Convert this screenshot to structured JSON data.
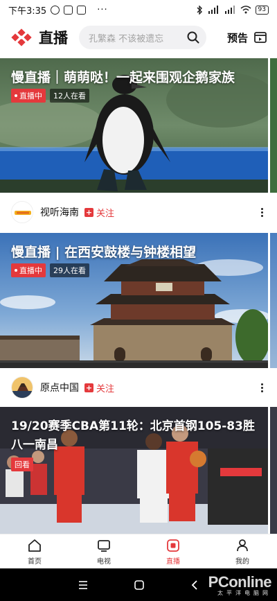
{
  "status_bar": {
    "time": "下午3:35",
    "dots": "···",
    "battery": "93"
  },
  "header": {
    "title": "直播",
    "search_placeholder": "孔繁森 不该被遗忘",
    "preview_label": "预告"
  },
  "cards": [
    {
      "title": "慢直播｜萌萌哒！一起来围观企鹅家族",
      "live_badge": "直播中",
      "viewers": "12人在看",
      "author": "视听海南",
      "follow_label": "关注"
    },
    {
      "title": "慢直播 | 在西安鼓楼与钟楼相望",
      "live_badge": "直播中",
      "viewers": "29人在看",
      "author": "原点中国",
      "follow_label": "关注"
    },
    {
      "title_line1": "19/20赛季CBA第11轮：北京首钢105-83胜",
      "title_line2": "八一南昌",
      "replay_badge": "回看"
    }
  ],
  "tabbar": {
    "items": [
      {
        "label": "首页",
        "icon": "home-icon"
      },
      {
        "label": "电视",
        "icon": "tv-icon"
      },
      {
        "label": "直播",
        "icon": "live-icon",
        "active": true
      },
      {
        "label": "我的",
        "icon": "profile-icon"
      }
    ]
  },
  "watermark": {
    "brand": "PConline",
    "sub": "太平洋电脑网"
  },
  "colors": {
    "accent": "#e4393c"
  }
}
